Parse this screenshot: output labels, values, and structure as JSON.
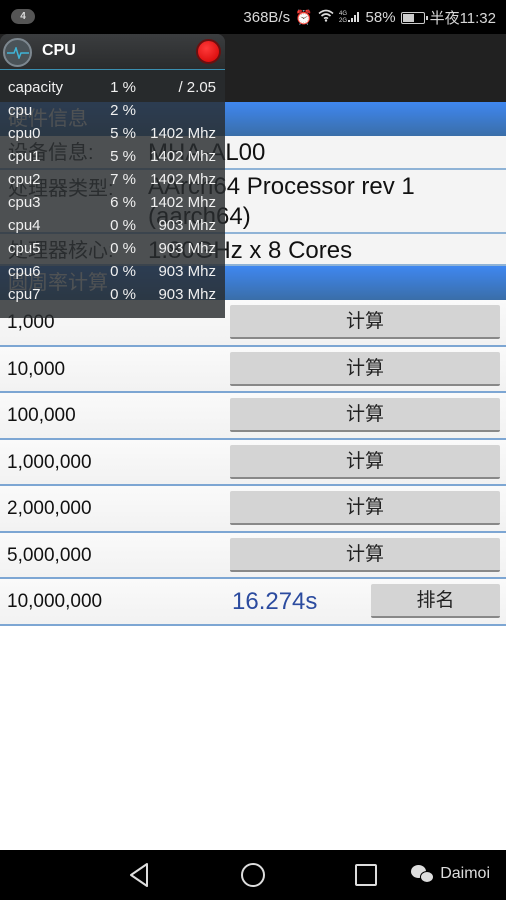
{
  "status_bar": {
    "notification_count": "4",
    "net_speed": "368B/s",
    "alarm_icon": "alarm-icon",
    "wifi_icon": "wifi-icon",
    "signal_label": "4G 2G",
    "battery_percent": "58%",
    "battery_level": 0.58,
    "time": "半夜11:32"
  },
  "app": {
    "section1_title": "硬件信息",
    "info": [
      {
        "label": "设备信息:",
        "value": "MHA-AL00"
      },
      {
        "label": "处理器类型:",
        "value": "AArch64 Processor rev 1 (aarch64)"
      },
      {
        "label": "处理器核心:",
        "value": "1.80GHz x 8 Cores"
      }
    ],
    "section2_title": "圆周率计算",
    "calc_rows": [
      {
        "digits": "1,000",
        "button": "计算"
      },
      {
        "digits": "10,000",
        "button": "计算"
      },
      {
        "digits": "100,000",
        "button": "计算"
      },
      {
        "digits": "1,000,000",
        "button": "计算"
      },
      {
        "digits": "2,000,000",
        "button": "计算"
      },
      {
        "digits": "5,000,000",
        "button": "计算"
      }
    ],
    "result_row": {
      "digits": "10,000,000",
      "result": "16.274s",
      "button": "排名"
    },
    "colors": {
      "accent": "#3f87f0",
      "result_text": "#2b4b9f"
    }
  },
  "cpu_overlay": {
    "title": "CPU",
    "rows": [
      {
        "name": "capacity",
        "percent": "1 %",
        "freq": "/ 2.05"
      },
      {
        "name": "cpu",
        "percent": "2 %",
        "freq": ""
      },
      {
        "name": "cpu0",
        "percent": "5 %",
        "freq": "1402 Mhz"
      },
      {
        "name": "cpu1",
        "percent": "5 %",
        "freq": "1402 Mhz"
      },
      {
        "name": "cpu2",
        "percent": "7 %",
        "freq": "1402 Mhz"
      },
      {
        "name": "cpu3",
        "percent": "6 %",
        "freq": "1402 Mhz"
      },
      {
        "name": "cpu4",
        "percent": "0 %",
        "freq": "903 Mhz"
      },
      {
        "name": "cpu5",
        "percent": "0 %",
        "freq": "903 Mhz"
      },
      {
        "name": "cpu6",
        "percent": "0 %",
        "freq": "903 Mhz"
      },
      {
        "name": "cpu7",
        "percent": "0 %",
        "freq": "903 Mhz"
      }
    ]
  },
  "nav_bar": {
    "back": "back-icon",
    "home": "home-icon",
    "recents": "recents-icon",
    "watermark": "Daimoi"
  }
}
